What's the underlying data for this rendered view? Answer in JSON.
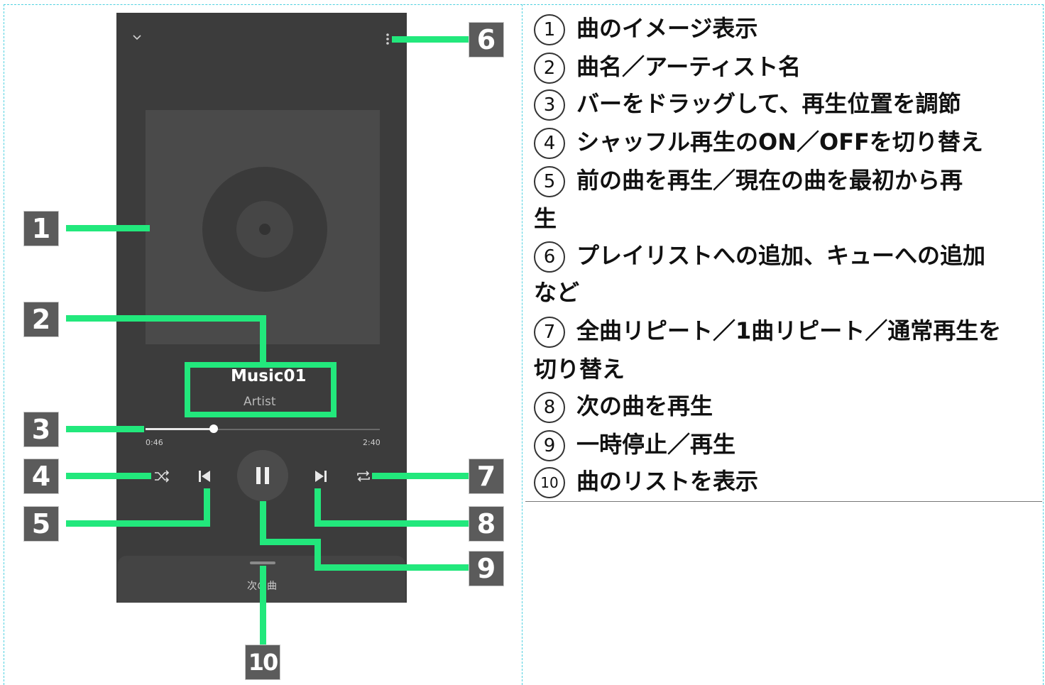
{
  "player": {
    "song_title": "Music01",
    "artist": "Artist",
    "current_time": "0:46",
    "total_time": "2:40",
    "progress": 0.29,
    "queue_label": "次の曲"
  },
  "badges": [
    "1",
    "2",
    "3",
    "4",
    "5",
    "6",
    "7",
    "8",
    "9",
    "10"
  ],
  "descriptions": [
    {
      "num": "1",
      "line1": "曲のイメージ表示",
      "line2": ""
    },
    {
      "num": "2",
      "line1": "曲名／アーティスト名",
      "line2": ""
    },
    {
      "num": "3",
      "line1": "バーをドラッグして、再生位置を調節",
      "line2": ""
    },
    {
      "num": "4",
      "line1": "シャッフル再生のON／OFFを切り替え",
      "line2": ""
    },
    {
      "num": "5",
      "line1": "前の曲を再生／現在の曲を最初から再",
      "line2": "生"
    },
    {
      "num": "6",
      "line1": "プレイリストへの追加、キューへの追加",
      "line2": "など"
    },
    {
      "num": "7",
      "line1": "全曲リピート／1曲リピート／通常再生を",
      "line2": "切り替え"
    },
    {
      "num": "8",
      "line1": "次の曲を再生",
      "line2": ""
    },
    {
      "num": "9",
      "line1": "一時停止／再生",
      "line2": ""
    },
    {
      "num": "10",
      "line1": "曲のリストを表示",
      "line2": ""
    }
  ],
  "colors": {
    "callout": "#22e87c",
    "phone_bg": "#3c3c3c",
    "badge_bg": "#5b5b5b"
  },
  "icons": [
    "chevron-down-icon",
    "more-vert-icon",
    "shuffle-icon",
    "skip-previous-icon",
    "pause-icon",
    "skip-next-icon",
    "repeat-icon",
    "disc-icon"
  ]
}
